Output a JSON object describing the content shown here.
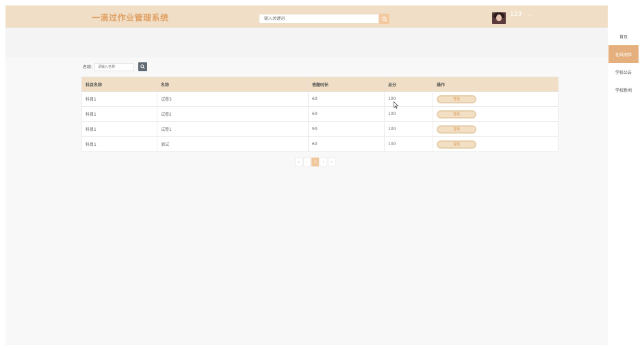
{
  "header": {
    "site_title": "一滴过作业管理系统",
    "search_placeholder": "输入关键词",
    "username": "123",
    "user_caret": "⌄"
  },
  "right_nav": [
    {
      "label": "首页",
      "active": false
    },
    {
      "label": "在线测验",
      "active": true
    },
    {
      "label": "学校公告",
      "active": false
    },
    {
      "label": "学校新闻",
      "active": false
    }
  ],
  "filter": {
    "label": "名称:",
    "placeholder": "请输入名称"
  },
  "table": {
    "headers": [
      "科目名称",
      "名称",
      "答题时长",
      "总分",
      "操作"
    ],
    "rows": [
      {
        "subject": "科目1",
        "name": "试卷3",
        "duration": "60",
        "score": "100",
        "action": "答题"
      },
      {
        "subject": "科目1",
        "name": "试卷2",
        "duration": "60",
        "score": "100",
        "action": "答题"
      },
      {
        "subject": "科目1",
        "name": "试卷1",
        "duration": "90",
        "score": "100",
        "action": "答题"
      },
      {
        "subject": "科目1",
        "name": "测试",
        "duration": "60",
        "score": "100",
        "action": "答题"
      }
    ]
  },
  "pagination": {
    "first": "«",
    "prev": "‹",
    "current": "1",
    "next": "›",
    "last": "»"
  },
  "colors": {
    "header_bg": "#f0dfc6",
    "accent": "#e5b07d",
    "title": "#e0a063"
  }
}
